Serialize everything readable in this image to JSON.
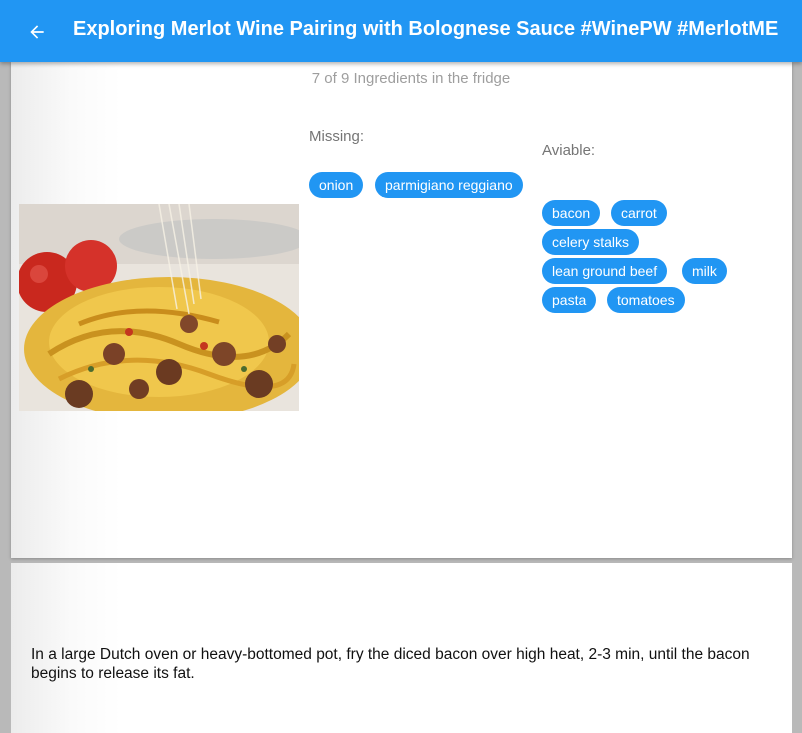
{
  "appbar": {
    "title": "Exploring Merlot Wine Pairing with Bolognese Sauce #WinePW #MerlotME",
    "back_icon": "arrow-back-icon"
  },
  "recipe": {
    "ingredient_count": "7 of 9 Ingredients in the fridge",
    "missing_label": "Missing:",
    "available_label": "Aviable:",
    "missing": [
      "onion",
      "parmigiano reggiano"
    ],
    "available": [
      "bacon",
      "carrot",
      "celery stalks",
      "lean ground beef",
      "milk",
      "pasta",
      "tomatoes"
    ],
    "instruction": "In a large Dutch oven or heavy-bottomed pot, fry the diced bacon over high heat, 2-3 min, until the bacon begins to release its fat."
  },
  "colors": {
    "primary": "#2196f3",
    "chip_text": "#ffffff"
  }
}
